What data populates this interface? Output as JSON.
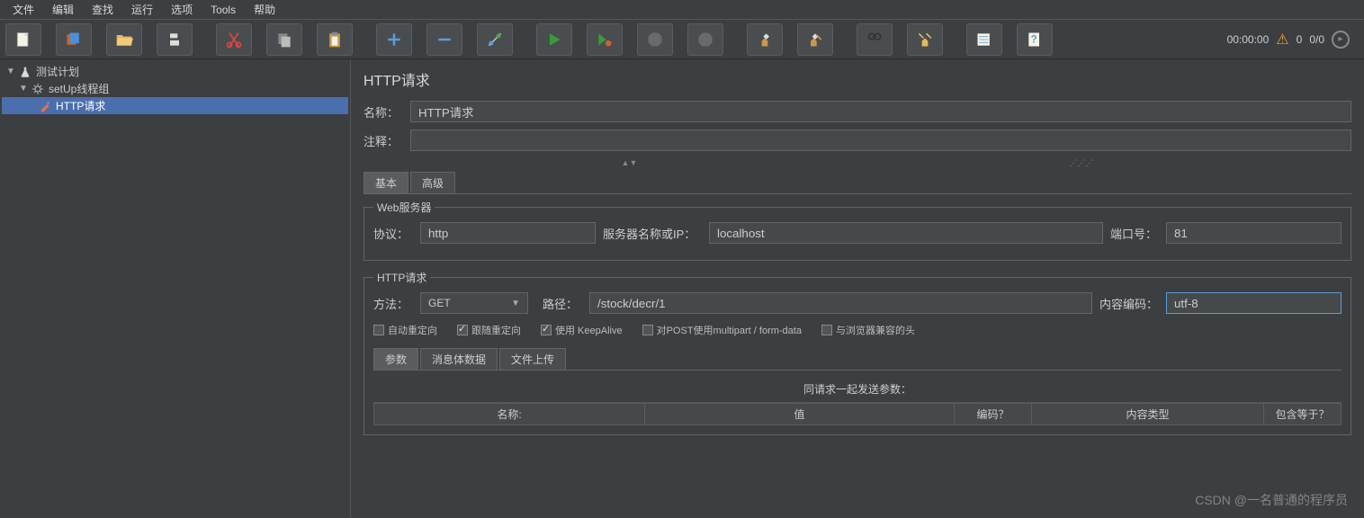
{
  "menu": [
    "文件",
    "编辑",
    "查找",
    "运行",
    "选项",
    "Tools",
    "帮助"
  ],
  "toolbar_status": {
    "timer": "00:00:00",
    "warn_count": "0",
    "threads": "0/0"
  },
  "tree": {
    "root": "测试计划",
    "group": "setUp线程组",
    "request": "HTTP请求"
  },
  "panel": {
    "title": "HTTP请求",
    "name_label": "名称：",
    "name_value": "HTTP请求",
    "comment_label": "注释：",
    "comment_value": "",
    "tabs": {
      "basic": "基本",
      "advanced": "高级"
    },
    "webserver": {
      "legend": "Web服务器",
      "protocol_label": "协议：",
      "protocol_value": "http",
      "server_label": "服务器名称或IP：",
      "server_value": "localhost",
      "port_label": "端口号：",
      "port_value": "81"
    },
    "httpreq": {
      "legend": "HTTP请求",
      "method_label": "方法：",
      "method_value": "GET",
      "path_label": "路径：",
      "path_value": "/stock/decr/1",
      "encoding_label": "内容编码：",
      "encoding_value": "utf-8"
    },
    "checkboxes": {
      "auto_redirect": "自动重定向",
      "follow_redirect": "跟随重定向",
      "keepalive": "使用 KeepAlive",
      "multipart": "对POST使用multipart / form-data",
      "browser_headers": "与浏览器兼容的头"
    },
    "param_tabs": {
      "params": "参数",
      "body": "消息体数据",
      "files": "文件上传"
    },
    "param_header": "同请求一起发送参数：",
    "columns": {
      "name": "名称:",
      "value": "值",
      "encode": "编码？",
      "type": "内容类型",
      "include": "包含等于？"
    }
  },
  "watermark": "CSDN @一名普通的程序员"
}
